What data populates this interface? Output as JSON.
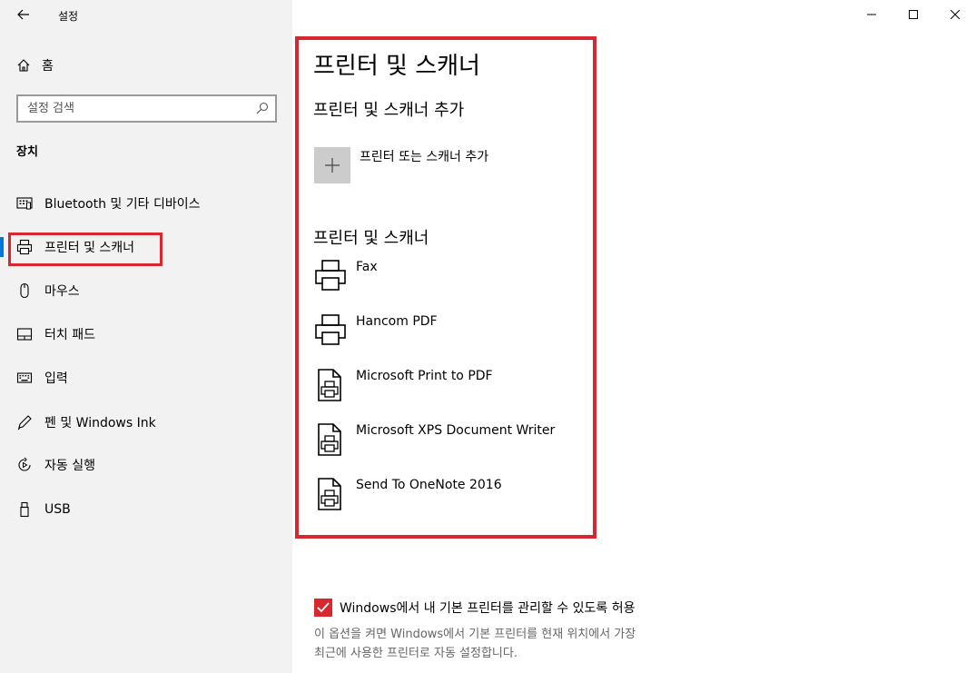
{
  "app": {
    "title": "설정"
  },
  "sidebar": {
    "home_label": "홈",
    "search_placeholder": "설정 검색",
    "section_label": "장치",
    "items": [
      {
        "label": "Bluetooth 및 기타 디바이스",
        "icon": "bluetooth-devices-icon"
      },
      {
        "label": "프린터 및 스캐너",
        "icon": "printer-icon",
        "active": true
      },
      {
        "label": "마우스",
        "icon": "mouse-icon"
      },
      {
        "label": "터치 패드",
        "icon": "touchpad-icon"
      },
      {
        "label": "입력",
        "icon": "keyboard-icon"
      },
      {
        "label": "펜 및 Windows Ink",
        "icon": "pen-icon"
      },
      {
        "label": "자동 실행",
        "icon": "autoplay-icon"
      },
      {
        "label": "USB",
        "icon": "usb-icon"
      }
    ]
  },
  "main": {
    "page_title": "프린터 및 스캐너",
    "add_section_title": "프린터 및 스캐너 추가",
    "add_button_label": "프린터 또는 스캐너 추가",
    "list_title": "프린터 및 스캐너",
    "printers": [
      {
        "name": "Fax",
        "icon": "printer-icon"
      },
      {
        "name": "Hancom PDF",
        "icon": "printer-icon"
      },
      {
        "name": "Microsoft Print to PDF",
        "icon": "document-printer-icon"
      },
      {
        "name": "Microsoft XPS Document Writer",
        "icon": "document-printer-icon"
      },
      {
        "name": "Send To OneNote 2016",
        "icon": "document-printer-icon"
      }
    ],
    "default_printer_checkbox": {
      "label": "Windows에서 내 기본 프린터를 관리할 수 있도록 허용",
      "checked": true
    },
    "default_printer_description_line1": "이 옵션을 켜면 Windows에서 기본 프린터를 현재 위치에서 가장",
    "default_printer_description_line2": "최근에 사용한 프린터로 자동 설정합니다."
  },
  "colors": {
    "accent": "#0078d7",
    "highlight": "#d7272f",
    "checkbox": "#d7272f",
    "sidebar_bg": "#f2f2f2"
  }
}
